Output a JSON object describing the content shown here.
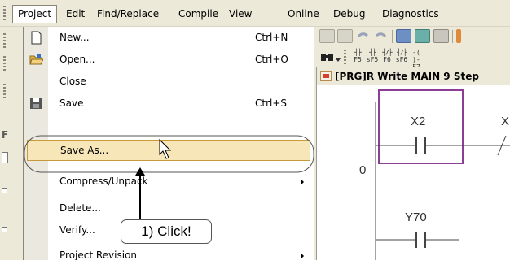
{
  "menubar": {
    "items": [
      {
        "label": "Project",
        "active": true
      },
      {
        "label": "Edit"
      },
      {
        "label": "Find/Replace"
      },
      {
        "label": "Compile"
      },
      {
        "label": "View"
      },
      {
        "label": "Online"
      },
      {
        "label": "Debug"
      },
      {
        "label": "Diagnostics"
      }
    ]
  },
  "project_menu": {
    "items": [
      {
        "label": "New...",
        "shortcut": "Ctrl+N",
        "icon": "new-document-icon"
      },
      {
        "label": "Open...",
        "shortcut": "Ctrl+O",
        "icon": "open-folder-icon"
      },
      {
        "label": "Close"
      },
      {
        "label": "Save",
        "shortcut": "Ctrl+S",
        "icon": "save-disk-icon"
      },
      {
        "label": "Save As...",
        "highlighted": true
      },
      {
        "label": "Compress/Unpack",
        "submenu": true
      },
      {
        "label": "Delete..."
      },
      {
        "label": "Verify..."
      },
      {
        "label": "Project Revision",
        "submenu": true
      }
    ]
  },
  "annotation": {
    "callout_text": "1) Click!"
  },
  "toolbar": {
    "fkeys": [
      {
        "top": "F5",
        "bottom": "sF5"
      },
      {
        "top": "F6",
        "bottom": "sF6"
      },
      {
        "top": "F7",
        "bottom": "F7"
      }
    ]
  },
  "program_window": {
    "title": "[PRG]R Write MAIN 9 Step",
    "ladder": {
      "contact_1": "X2",
      "contact_2": "X",
      "coil": "Y70",
      "step": "0"
    }
  },
  "colors": {
    "menu_bg": "#ece9d8",
    "highlight_fill": "#f7e6b8",
    "highlight_border": "#c79a3a",
    "ladder_selection": "#8a3e94"
  }
}
